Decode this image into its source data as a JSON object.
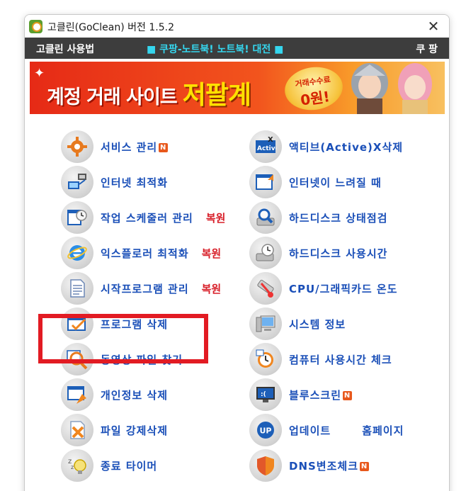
{
  "window": {
    "title": "고클린(GoClean) 버전 1.5.2",
    "close_symbol": "✕"
  },
  "menubar": {
    "left": "고클린 사용법",
    "middle": "■ 쿠팡-노트북! 노트북! 대전 ■",
    "right": "쿠 팡"
  },
  "banner": {
    "text": "계정 거래 사이트",
    "emphasis": "저팔계",
    "badge_line1": "거래수수료",
    "badge_line2": "0원!"
  },
  "left_items": [
    {
      "label": "서비스 관리",
      "badge": "N",
      "restore": "",
      "icon": "gear-icon"
    },
    {
      "label": "인터넷 최적화",
      "badge": "",
      "restore": "",
      "icon": "network-monitor-icon"
    },
    {
      "label": "작업 스케줄러 관리",
      "badge": "",
      "restore": "복원",
      "icon": "scheduler-clock-icon"
    },
    {
      "label": "익스플로러 최적화",
      "badge": "",
      "restore": "복원",
      "icon": "internet-explorer-icon"
    },
    {
      "label": "시작프로그램 관리",
      "badge": "",
      "restore": "복원",
      "icon": "document-icon"
    },
    {
      "label": "프로그램 삭제",
      "badge": "",
      "restore": "",
      "icon": "program-uninstall-icon"
    },
    {
      "label": "동영상 파일 찾기",
      "badge": "",
      "restore": "",
      "icon": "magnifier-icon"
    },
    {
      "label": "개인정보 삭제",
      "badge": "",
      "restore": "",
      "icon": "privacy-window-icon"
    },
    {
      "label": "파일 강제삭제",
      "badge": "",
      "restore": "",
      "icon": "file-delete-icon"
    },
    {
      "label": "종료 타이머",
      "badge": "",
      "restore": "",
      "icon": "sleep-bulb-icon"
    }
  ],
  "right_items": [
    {
      "label": "액티브(Active)X삭제",
      "badge": "",
      "icon": "activex-icon"
    },
    {
      "label": "인터넷이 느려질 때",
      "badge": "",
      "icon": "internet-arrow-icon"
    },
    {
      "label": "하드디스크 상태점검",
      "badge": "",
      "icon": "disk-search-icon"
    },
    {
      "label": "하드디스크 사용시간",
      "badge": "",
      "icon": "disk-clock-icon"
    },
    {
      "label": "CPU/그래픽카드 온도",
      "badge": "",
      "icon": "thermometer-icon"
    },
    {
      "label": "시스템 정보",
      "badge": "",
      "icon": "computer-icon"
    },
    {
      "label": "컴퓨터 사용시간 체크",
      "badge": "",
      "icon": "alarm-clock-icon"
    },
    {
      "label": "블루스크린",
      "badge": "N",
      "icon": "bluescreen-monitor-icon"
    },
    {
      "label": "업데이트",
      "badge": "",
      "icon": "update-icon",
      "extra": "홈페이지"
    },
    {
      "label": "DNS변조체크",
      "badge": "N",
      "icon": "shield-icon"
    }
  ],
  "colors": {
    "label_blue": "#1a4fb8",
    "restore_red": "#d8202a",
    "highlight_red": "#e21b23",
    "menubar_bg": "#3d3d3d",
    "menu_cyan": "#35d6ee"
  }
}
